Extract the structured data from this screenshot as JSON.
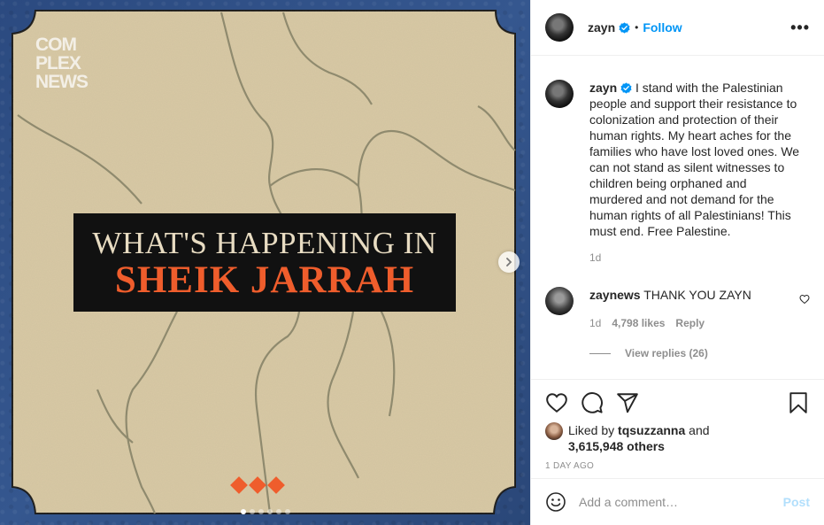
{
  "media": {
    "brand_lines": [
      "COM",
      "PLEX",
      "NEWS"
    ],
    "headline_top": "WHAT'S HAPPENING IN",
    "headline_bottom": "SHEIK JARRAH",
    "carousel_count": 6,
    "carousel_active": 0,
    "colors": {
      "frame": "#2f4f86",
      "paper": "#d8c9a5",
      "accent": "#ef5d2c"
    }
  },
  "header": {
    "username": "zayn",
    "separator": "•",
    "follow_label": "Follow",
    "more_label": "•••"
  },
  "caption": {
    "username": "zayn",
    "text": "I stand with the Palestinian people and support their resistance to colonization and protection of their human rights. My heart aches for the families who have lost loved ones. We can not stand as silent witnesses to children being orphaned and murdered and not demand for the human rights of all Palestinians! This must end. Free Palestine.",
    "time": "1d"
  },
  "comment": {
    "username": "zaynews",
    "text": "THANK YOU ZAYN",
    "time": "1d",
    "likes": "4,798 likes",
    "reply_label": "Reply",
    "view_replies": "View replies (26)"
  },
  "likes": {
    "prefix": "Liked by",
    "user": "tqsuzzanna",
    "and": "and",
    "others": "3,615,948 others",
    "date": "1 DAY AGO"
  },
  "add_comment": {
    "placeholder": "Add a comment…",
    "post_label": "Post"
  },
  "icons": [
    "heart-icon",
    "comment-icon",
    "share-icon",
    "bookmark-icon",
    "emoji-icon",
    "verified-icon",
    "chevron-right-icon"
  ]
}
